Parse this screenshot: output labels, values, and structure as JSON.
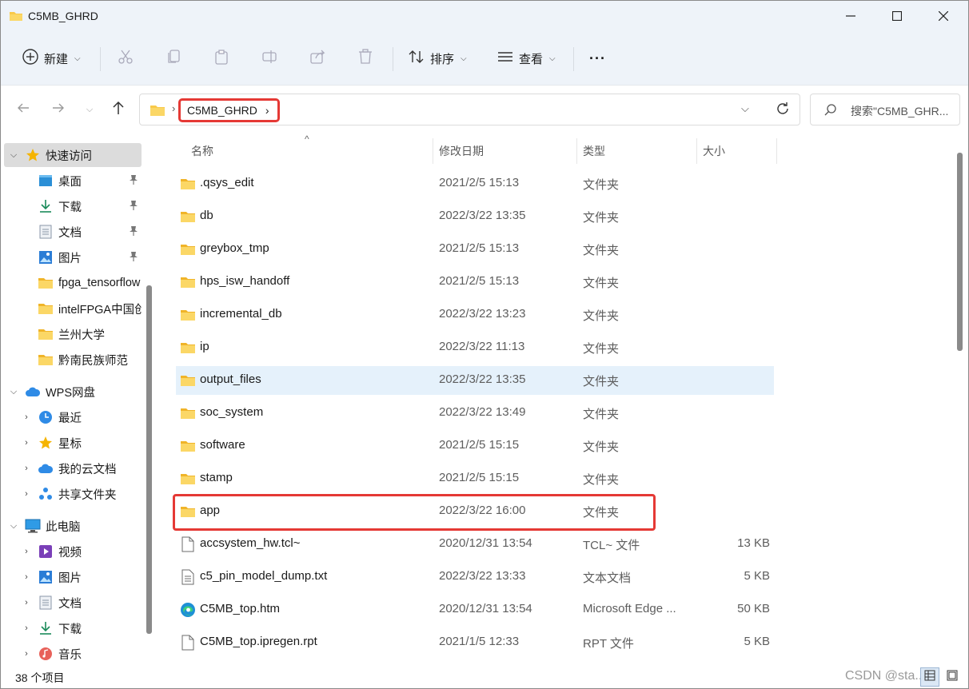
{
  "window": {
    "title": "C5MB_GHRD"
  },
  "toolbar": {
    "new_label": "新建",
    "sort_label": "排序",
    "view_label": "查看",
    "more_label": "···"
  },
  "address": {
    "crumb": "C5MB_GHRD"
  },
  "search": {
    "placeholder": "搜索\"C5MB_GHR..."
  },
  "sidebar": {
    "items": [
      {
        "label": "快速访问",
        "icon": "star-icon",
        "expander": "v"
      },
      {
        "label": "桌面",
        "icon": "desktop-icon",
        "pinned": true
      },
      {
        "label": "下载",
        "icon": "download-icon",
        "pinned": true
      },
      {
        "label": "文档",
        "icon": "document-icon",
        "pinned": true
      },
      {
        "label": "图片",
        "icon": "pictures-icon",
        "pinned": true
      },
      {
        "label": "fpga_tensorflow",
        "icon": "folder-icon"
      },
      {
        "label": "intelFPGA中国创",
        "icon": "folder-icon"
      },
      {
        "label": "兰州大学",
        "icon": "folder-icon"
      },
      {
        "label": "黔南民族师范",
        "icon": "folder-icon"
      },
      {
        "label": "WPS网盘",
        "icon": "cloud-icon",
        "expander": "v"
      },
      {
        "label": "最近",
        "icon": "clock-icon",
        "expander": ">"
      },
      {
        "label": "星标",
        "icon": "star-icon",
        "expander": ">"
      },
      {
        "label": "我的云文档",
        "icon": "cloud-icon",
        "expander": ">"
      },
      {
        "label": "共享文件夹",
        "icon": "share-icon",
        "expander": ">"
      },
      {
        "label": "此电脑",
        "icon": "computer-icon",
        "expander": "v"
      },
      {
        "label": "视频",
        "icon": "video-icon",
        "expander": ">"
      },
      {
        "label": "图片",
        "icon": "pictures-icon",
        "expander": ">"
      },
      {
        "label": "文档",
        "icon": "document-icon",
        "expander": ">"
      },
      {
        "label": "下载",
        "icon": "download-icon",
        "expander": ">"
      },
      {
        "label": "音乐",
        "icon": "music-icon",
        "expander": ">"
      }
    ]
  },
  "columns": {
    "name": "名称",
    "modified": "修改日期",
    "type": "类型",
    "size": "大小"
  },
  "files": [
    {
      "name": ".qsys_edit",
      "date": "2021/2/5 15:13",
      "type": "文件夹",
      "size": "",
      "icon": "folder-icon"
    },
    {
      "name": "db",
      "date": "2022/3/22 13:35",
      "type": "文件夹",
      "size": "",
      "icon": "folder-icon"
    },
    {
      "name": "greybox_tmp",
      "date": "2021/2/5 15:13",
      "type": "文件夹",
      "size": "",
      "icon": "folder-icon"
    },
    {
      "name": "hps_isw_handoff",
      "date": "2021/2/5 15:13",
      "type": "文件夹",
      "size": "",
      "icon": "folder-icon"
    },
    {
      "name": "incremental_db",
      "date": "2022/3/22 13:23",
      "type": "文件夹",
      "size": "",
      "icon": "folder-icon"
    },
    {
      "name": "ip",
      "date": "2022/3/22 11:13",
      "type": "文件夹",
      "size": "",
      "icon": "folder-icon"
    },
    {
      "name": "output_files",
      "date": "2022/3/22 13:35",
      "type": "文件夹",
      "size": "",
      "icon": "folder-icon",
      "hover": true
    },
    {
      "name": "soc_system",
      "date": "2022/3/22 13:49",
      "type": "文件夹",
      "size": "",
      "icon": "folder-icon"
    },
    {
      "name": "software",
      "date": "2021/2/5 15:15",
      "type": "文件夹",
      "size": "",
      "icon": "folder-icon"
    },
    {
      "name": "stamp",
      "date": "2021/2/5 15:15",
      "type": "文件夹",
      "size": "",
      "icon": "folder-icon"
    },
    {
      "name": "app",
      "date": "2022/3/22 16:00",
      "type": "文件夹",
      "size": "",
      "icon": "folder-icon",
      "highlighted": true
    },
    {
      "name": "accsystem_hw.tcl~",
      "date": "2020/12/31 13:54",
      "type": "TCL~ 文件",
      "size": "13 KB",
      "icon": "file-icon"
    },
    {
      "name": "c5_pin_model_dump.txt",
      "date": "2022/3/22 13:33",
      "type": "文本文档",
      "size": "5 KB",
      "icon": "text-file-icon"
    },
    {
      "name": "C5MB_top.htm",
      "date": "2020/12/31 13:54",
      "type": "Microsoft Edge ...",
      "size": "50 KB",
      "icon": "edge-icon"
    },
    {
      "name": "C5MB_top.ipregen.rpt",
      "date": "2021/1/5 12:33",
      "type": "RPT 文件",
      "size": "5 KB",
      "icon": "file-icon"
    }
  ],
  "status": {
    "count": "38 个项目",
    "watermark": "CSDN @sta..."
  },
  "colors": {
    "accent": "#0067c0",
    "highlight_box": "#e53935",
    "hover_row": "#e5f1fb",
    "folder": "#f8c94a"
  }
}
